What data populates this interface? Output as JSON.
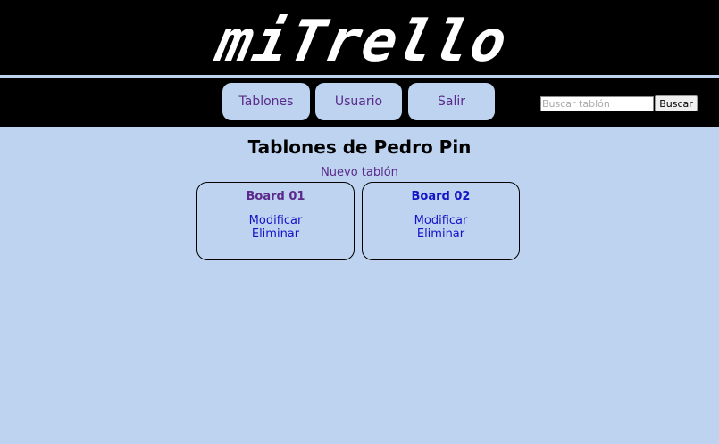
{
  "header": {
    "logo_text": "miTrello"
  },
  "nav": {
    "items": [
      {
        "label": "Tablones"
      },
      {
        "label": "Usuario"
      },
      {
        "label": "Salir"
      }
    ]
  },
  "search": {
    "placeholder": "Buscar tablón",
    "value": "",
    "button_label": "Buscar"
  },
  "main": {
    "title": "Tablones de Pedro Pin",
    "new_board_label": "Nuevo tablón",
    "boards": [
      {
        "title": "Board 01",
        "modify_label": "Modificar",
        "delete_label": "Eliminar"
      },
      {
        "title": "Board 02",
        "modify_label": "Modificar",
        "delete_label": "Eliminar"
      }
    ]
  },
  "colors": {
    "page_background": "#bdd3ef",
    "header_background": "#000000",
    "nav_button_background": "#bdd3ef",
    "visited_link": "#5b2a8c",
    "link": "#1414c8"
  }
}
